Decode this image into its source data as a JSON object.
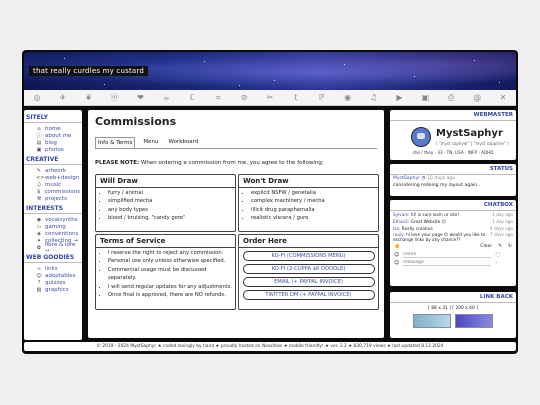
{
  "banner": {
    "title": "that really curdles my custard"
  },
  "iconbar": {
    "icons": [
      "globe-icon",
      "bird-icon",
      "butterfly-icon",
      "mastodon-icon",
      "heart-icon",
      "coffee-icon",
      "c-icon",
      "crop-icon",
      "ban-icon",
      "sewing-icon",
      "tumblr-icon",
      "p-icon",
      "github-icon",
      "music-icon",
      "video-icon",
      "youtube-icon",
      "printer-icon",
      "at-icon",
      "x-icon"
    ]
  },
  "sidebar": {
    "sections": [
      {
        "title": "SITELY",
        "items": [
          {
            "icon": "home-icon",
            "glyph": "⌂",
            "label": "home"
          },
          {
            "icon": "info-icon",
            "glyph": "ⓘ",
            "label": "about me"
          },
          {
            "icon": "book-icon",
            "glyph": "▤",
            "label": "blog"
          },
          {
            "icon": "camera-icon",
            "glyph": "▣",
            "label": "photos"
          }
        ]
      },
      {
        "title": "CREATIVE",
        "items": [
          {
            "icon": "brush-icon",
            "glyph": "✎",
            "label": "artwork"
          },
          {
            "icon": "code-icon",
            "glyph": "<>",
            "label": "web+design"
          },
          {
            "icon": "music-icon",
            "glyph": "♫",
            "label": "music"
          },
          {
            "icon": "dollar-icon",
            "glyph": "$",
            "label": "commissions"
          },
          {
            "icon": "tools-icon",
            "glyph": "⚒",
            "label": "projects"
          }
        ]
      },
      {
        "title": "INTERESTS",
        "items": [
          {
            "icon": "vocal-icon",
            "glyph": "◉",
            "label": "vocalsynths"
          },
          {
            "icon": "gamepad-icon",
            "glyph": "▭",
            "label": "gaming"
          },
          {
            "icon": "convention-icon",
            "glyph": "◈",
            "label": "conventions"
          },
          {
            "icon": "collect-icon",
            "glyph": "✦",
            "label": "collecting →"
          },
          {
            "icon": "yarn-icon",
            "glyph": "✿",
            "label": "fibre & lore →"
          }
        ]
      },
      {
        "title": "WEB GOODIES",
        "items": [
          {
            "icon": "link-icon",
            "glyph": "∞",
            "label": "links"
          },
          {
            "icon": "adopt-icon",
            "glyph": "☺",
            "label": "adoptables"
          },
          {
            "icon": "quiz-icon",
            "glyph": "?",
            "label": "quizzes"
          },
          {
            "icon": "graphic-icon",
            "glyph": "▧",
            "label": "graphics"
          }
        ]
      }
    ]
  },
  "main": {
    "title": "Commissions",
    "tabs": [
      "Info & Terms",
      "Menu",
      "Workboard"
    ],
    "notice_strong": "PLEASE NOTE:",
    "notice": " When ordering a commission from me, you agree to the following:",
    "will_draw": {
      "title": "Will Draw",
      "items": [
        "furry / animal",
        "simplified mecha",
        "any body types",
        "blood / bruising, \"candy gore\""
      ]
    },
    "wont_draw": {
      "title": "Won't Draw",
      "items": [
        "explicit NSFW / genetalia",
        "complex machinery / mecha",
        "illicit drug paraphernalia",
        "realistic viscera / guro"
      ]
    },
    "terms": {
      "title": "Terms of Service",
      "items": [
        "I reserve the right to reject any commission.",
        "Personal use only unless otherwise specified.",
        "Commercial usage must be discussed separately.",
        "I will send regular updates for any adjustments.",
        "Once final is approved, there are NO refunds."
      ]
    },
    "order": {
      "title": "Order Here",
      "buttons": [
        "KO-FI (COMMISSIONS MENU)",
        "KO-FI (2-CUPPA $6 DOODLE)",
        "EMAIL (+ PAYPAL INVOICE)",
        "TWITTER DM (+ PAYPAL INVOICE)"
      ]
    }
  },
  "webmaster": {
    "header": "WEBMASTER",
    "name": "MystSaphyr",
    "sub": "( \"myst saphyer\" | \"myst sapphire\" )",
    "info": "she / they · 33 · TN, USA · INFP · ADHD"
  },
  "status": {
    "header": "STATUS",
    "user": "MystSaphyr",
    "time": "10 days ago",
    "text": "considering redoing my layout again.."
  },
  "chatbox": {
    "header": "CHATBOX",
    "messages": [
      {
        "user": "Sylvain:",
        "text": "hi! is sure lovin ur site!",
        "time": "1 day ago"
      },
      {
        "user": "Ethan2:",
        "text": "Great Website 😊",
        "time": "1 day ago"
      },
      {
        "user": "Isa:",
        "text": "Really creative",
        "time": "4 days ago"
      },
      {
        "user": "ruuiy:",
        "text": "hi love your page 😊 would you like to exchange links by any chance??",
        "time": "7 days ago"
      }
    ],
    "clear_label": "Clear",
    "name_placeholder": "name",
    "message_placeholder": "message"
  },
  "linkback": {
    "header": "LINK BACK",
    "sizes": "[ 88 x 31 ]   [ 200 x 40 ]"
  },
  "footer": {
    "text": "© 2019 - 2024 MystSaphyr  ★  coded lovingly by hand  ★  proudly hosted on Neocities  ★  mobile friendly!  ★  ver. 2.2  ★  830,719 views  ★  last updated 8.12.2024"
  }
}
